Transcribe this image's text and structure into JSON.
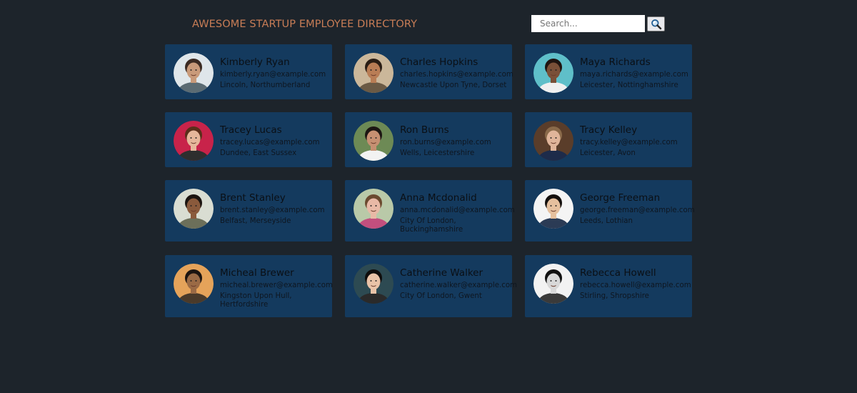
{
  "header": {
    "title": "AWESOME STARTUP EMPLOYEE DIRECTORY"
  },
  "search": {
    "placeholder": "Search...",
    "value": "",
    "button_icon": "search-icon"
  },
  "employees": [
    {
      "name": "Kimberly Ryan",
      "email": "kimberly.ryan@example.com",
      "location": "Lincoln, Northumberland"
    },
    {
      "name": "Charles Hopkins",
      "email": "charles.hopkins@example.com",
      "location": "Newcastle Upon Tyne, Dorset"
    },
    {
      "name": "Maya Richards",
      "email": "maya.richards@example.com",
      "location": "Leicester, Nottinghamshire"
    },
    {
      "name": "Tracey Lucas",
      "email": "tracey.lucas@example.com",
      "location": "Dundee, East Sussex"
    },
    {
      "name": "Ron Burns",
      "email": "ron.burns@example.com",
      "location": "Wells, Leicestershire"
    },
    {
      "name": "Tracy Kelley",
      "email": "tracy.kelley@example.com",
      "location": "Leicester, Avon"
    },
    {
      "name": "Brent Stanley",
      "email": "brent.stanley@example.com",
      "location": "Belfast, Merseyside"
    },
    {
      "name": "Anna Mcdonalid",
      "email": "anna.mcdonalid@example.com",
      "location": "City Of London, Buckinghamshire"
    },
    {
      "name": "George Freeman",
      "email": "george.freeman@example.com",
      "location": "Leeds, Lothian"
    },
    {
      "name": "Micheal Brewer",
      "email": "micheal.brewer@example.com",
      "location": "Kingston Upon Hull, Hertfordshire"
    },
    {
      "name": "Catherine Walker",
      "email": "catherine.walker@example.com",
      "location": "City Of London, Gwent"
    },
    {
      "name": "Rebecca Howell",
      "email": "rebecca.howell@example.com",
      "location": "Stirling, Shropshire"
    }
  ],
  "colors": {
    "page_background": "#1d242b",
    "card_background": "#143a5e",
    "title": "#c87d56"
  }
}
